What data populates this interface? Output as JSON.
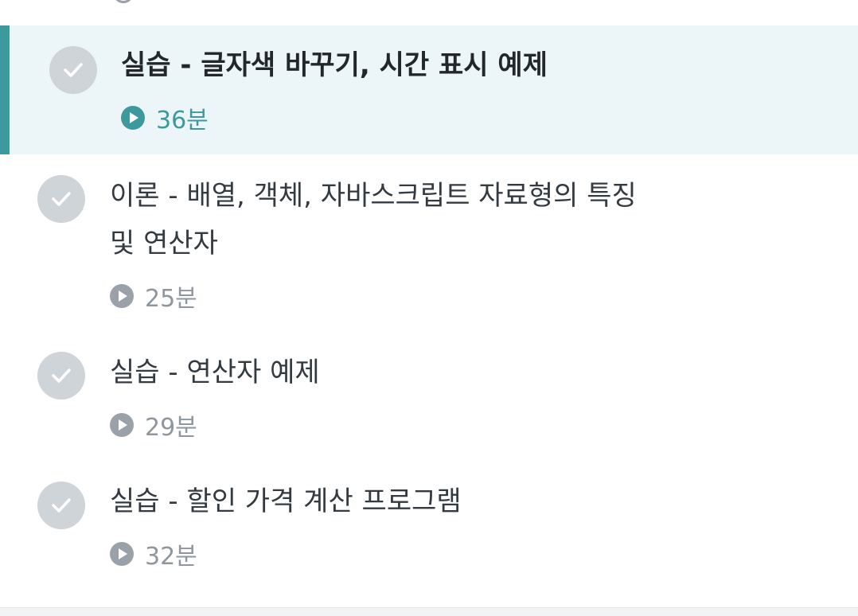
{
  "lessons": [
    {
      "title": "실습 - 글자색 바꾸기, 시간 표시 예제",
      "duration": "36분",
      "active": true
    },
    {
      "title_line1": "이론 - 배열, 객체, 자바스크립트 자료형의 특징",
      "title_line2": "및 연산자",
      "duration": "25분"
    },
    {
      "title": "실습 - 연산자 예제",
      "duration": "29분"
    },
    {
      "title": "실습 - 할인 가격 계산 프로그램",
      "duration": "32분"
    }
  ],
  "icons": {
    "completed": "check-icon",
    "video": "play-icon"
  },
  "colors": {
    "accent": "#3d9a9c",
    "active_bg": "#ecf5f7",
    "check_bg": "#cfd4d9",
    "muted": "#8e969e"
  }
}
